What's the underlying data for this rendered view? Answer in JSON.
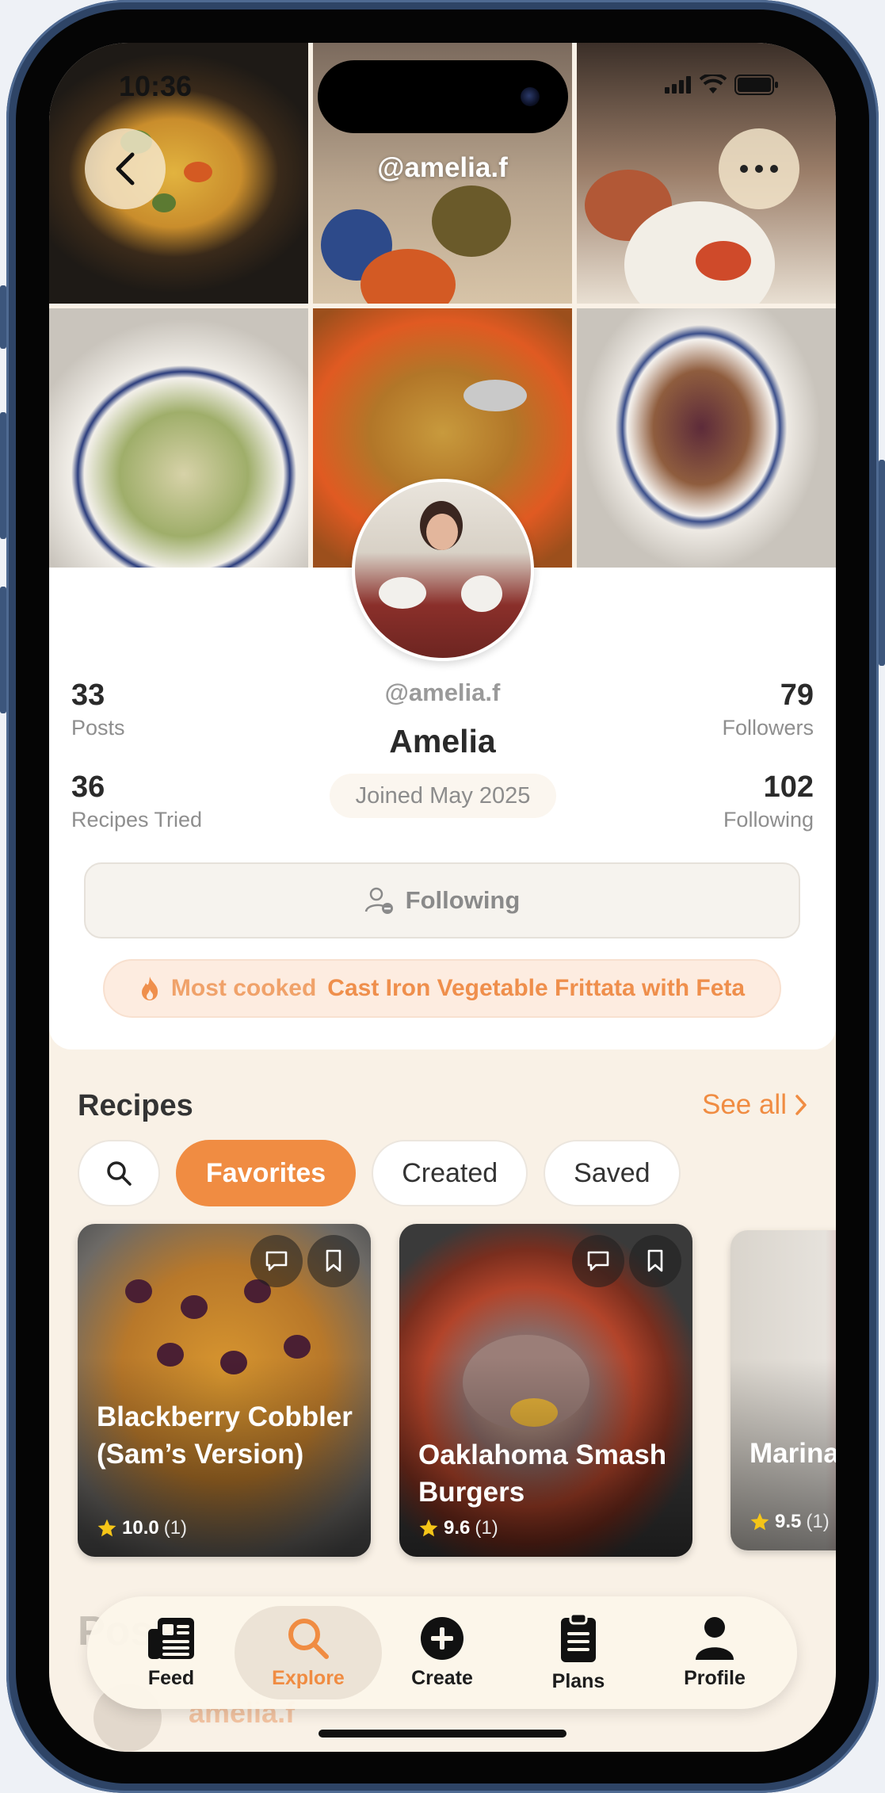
{
  "status_bar": {
    "time": "10:36"
  },
  "header": {
    "handle": "@amelia.f"
  },
  "profile": {
    "handle": "@amelia.f",
    "name": "Amelia",
    "joined": "Joined May 2025",
    "stats": {
      "posts": {
        "value": "33",
        "label": "Posts"
      },
      "recipes_tried": {
        "value": "36",
        "label": "Recipes Tried"
      },
      "followers": {
        "value": "79",
        "label": "Followers"
      },
      "following": {
        "value": "102",
        "label": "Following"
      }
    },
    "follow_button": "Following",
    "most_cooked": {
      "label": "Most cooked",
      "recipe": "Cast Iron Vegetable Frittata with Feta"
    }
  },
  "recipes_section": {
    "title": "Recipes",
    "see_all": "See all",
    "filters": [
      "Favorites",
      "Created",
      "Saved"
    ],
    "active_filter": "Favorites",
    "cards": [
      {
        "title": "Blackberry Cobbler (Sam’s Version)",
        "rating": "10.0",
        "count": "(1)"
      },
      {
        "title": "Oaklahoma Smash Burgers",
        "rating": "9.6",
        "count": "(1)"
      },
      {
        "title": "Marina Red Or",
        "rating": "9.5",
        "count": "(1)"
      }
    ]
  },
  "posts_section": {
    "title": "Posts",
    "first_author": "amelia.f"
  },
  "tabbar": {
    "active": "Explore",
    "items": [
      {
        "label": "Feed",
        "icon": "feed-icon"
      },
      {
        "label": "Explore",
        "icon": "search-icon"
      },
      {
        "label": "Create",
        "icon": "plus-circle-icon"
      },
      {
        "label": "Plans",
        "icon": "clipboard-icon"
      },
      {
        "label": "Profile",
        "icon": "person-icon"
      }
    ]
  },
  "colors": {
    "accent": "#f08c42",
    "background": "#f9f1e6",
    "card": "#ffffff"
  }
}
